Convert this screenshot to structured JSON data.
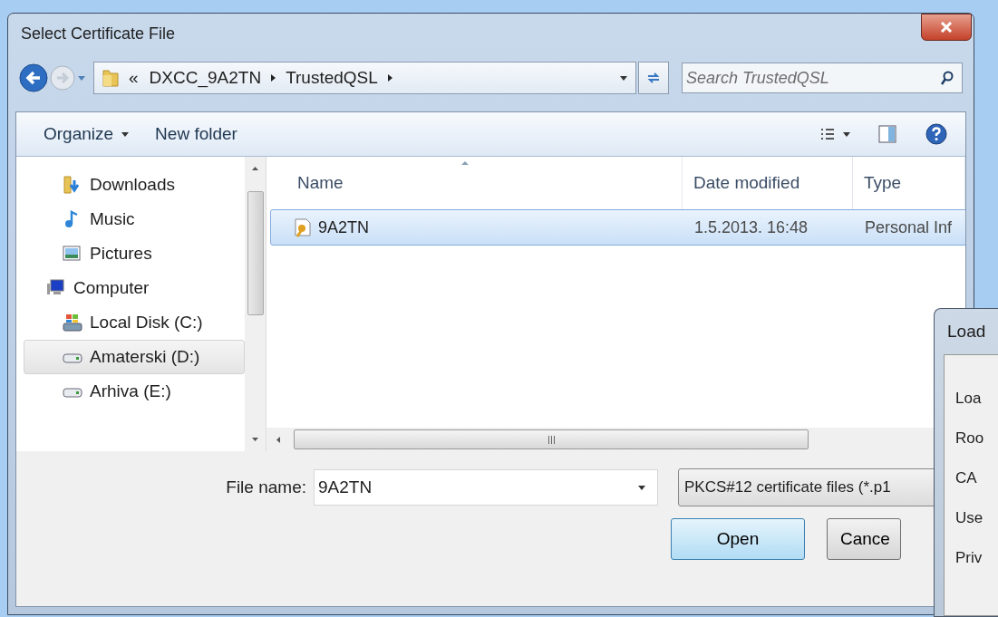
{
  "dialog": {
    "title": "Select Certificate File",
    "address": {
      "breadcrumbs": [
        "«",
        "DXCC_9A2TN",
        "TrustedQSL"
      ]
    },
    "search": {
      "placeholder": "Search TrustedQSL"
    },
    "toolbar": [
      {
        "label": "Organize",
        "kind": "menu"
      },
      {
        "label": "New folder",
        "kind": "button"
      }
    ],
    "navigation": [
      {
        "label": "Downloads",
        "kind": "downloads",
        "selected": false
      },
      {
        "label": "Music",
        "kind": "music",
        "selected": false
      },
      {
        "label": "Pictures",
        "kind": "pictures",
        "selected": false
      },
      {
        "label": "Computer",
        "kind": "computer",
        "selected": false,
        "children": [
          {
            "label": "Local Disk (C:)",
            "kind": "system-disk",
            "selected": false
          },
          {
            "label": "Amaterski (D:)",
            "kind": "drive",
            "selected": true
          },
          {
            "label": "Arhiva (E:)",
            "kind": "drive",
            "selected": false
          }
        ]
      }
    ],
    "file_list": {
      "columns": [
        "Name",
        "Date modified",
        "Type"
      ],
      "rows": [
        {
          "cells": [
            "9A2TN",
            "1.5.2013. 16:48",
            "Personal Inf"
          ],
          "selected": true
        }
      ]
    },
    "file_name": {
      "label": "File name:",
      "value": "9A2TN"
    },
    "file_type": {
      "value": "PKCS#12 certificate files (*.p1"
    },
    "buttons": [
      {
        "label": "Open",
        "kind": "default"
      },
      {
        "label": "Cance",
        "kind": "normal"
      }
    ]
  },
  "load_dialog": {
    "title": "Load",
    "labels": [
      "Loa",
      "Roo",
      "CA",
      "Use",
      "Priv"
    ]
  }
}
